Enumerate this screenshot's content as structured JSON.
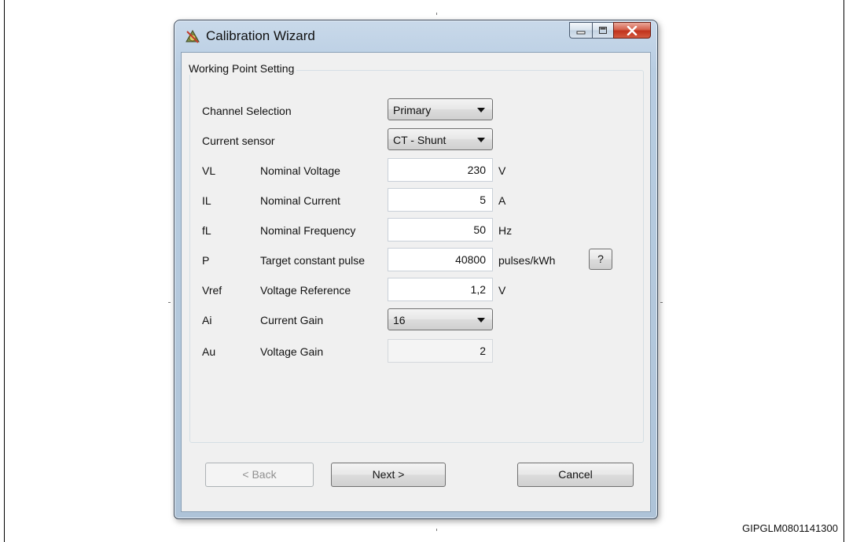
{
  "window": {
    "title": "Calibration Wizard",
    "icon": "calibration-wizard-icon"
  },
  "caption_buttons": [
    "minimize-icon",
    "maximize-icon",
    "close-icon"
  ],
  "group": {
    "title": "Working Point Setting"
  },
  "channel_selection": {
    "label": "Channel Selection",
    "value": "Primary"
  },
  "current_sensor": {
    "label": "Current sensor",
    "value": "CT - Shunt"
  },
  "rows": [
    {
      "symbol": "VL",
      "label": "Nominal Voltage",
      "value": "230",
      "unit": "V"
    },
    {
      "symbol": "IL",
      "label": "Nominal Current",
      "value": "5",
      "unit": "A"
    },
    {
      "symbol": "fL",
      "label": "Nominal Frequency",
      "value": "50",
      "unit": "Hz"
    },
    {
      "symbol": "P",
      "label": "Target constant pulse",
      "value": "40800",
      "unit": "pulses/kWh"
    },
    {
      "symbol": "Vref",
      "label": "Voltage Reference",
      "value": "1,2",
      "unit": "V"
    }
  ],
  "current_gain": {
    "symbol": "Ai",
    "label": "Current Gain",
    "value": "16"
  },
  "voltage_gain": {
    "symbol": "Au",
    "label": "Voltage Gain",
    "value": "2"
  },
  "help_button": "?",
  "buttons": {
    "back": "< Back",
    "next": "Next >",
    "cancel": "Cancel"
  },
  "figure_id": "GIPGLM0801141300",
  "colors": {
    "close_button": "#c1321c",
    "window_frame": "#b8cde2",
    "client_bg": "#f0f0f0"
  }
}
